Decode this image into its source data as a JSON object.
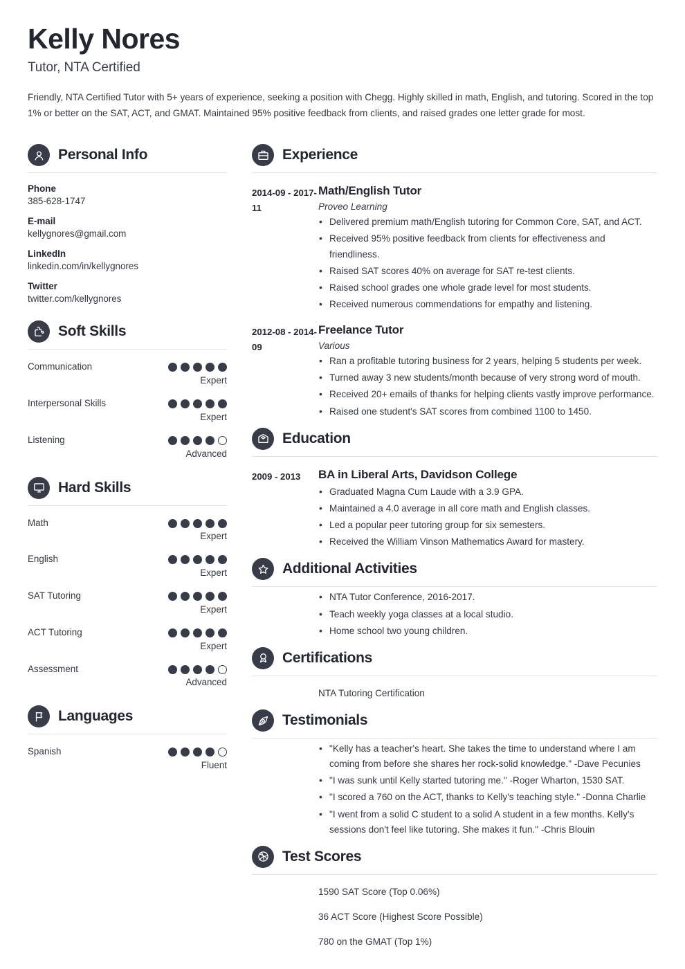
{
  "header": {
    "name": "Kelly Nores",
    "job_title": "Tutor, NTA Certified",
    "summary": "Friendly, NTA Certified Tutor with 5+ years of experience, seeking a position with Chegg. Highly skilled in math, English, and tutoring. Scored in the top 1% or better on the SAT, ACT, and GMAT. Maintained 95% positive feedback from clients, and raised grades one letter grade for most."
  },
  "theme": {
    "icon_circle": "#383c48",
    "text": "#33373f",
    "heading": "#23262f",
    "rule": "#e1e2e5"
  },
  "sidebar": {
    "personal_info": {
      "title": "Personal Info",
      "icon": "user-icon",
      "items": [
        {
          "label": "Phone",
          "value": "385-628-1747"
        },
        {
          "label": "E-mail",
          "value": "kellygnores@gmail.com"
        },
        {
          "label": "LinkedIn",
          "value": "linkedin.com/in/kellygnores"
        },
        {
          "label": "Twitter",
          "value": "twitter.com/kellygnores"
        }
      ]
    },
    "soft_skills": {
      "title": "Soft Skills",
      "icon": "puzzle-piece-icon",
      "items": [
        {
          "name": "Communication",
          "filled": 5,
          "total": 5,
          "level": "Expert"
        },
        {
          "name": "Interpersonal Skills",
          "filled": 5,
          "total": 5,
          "level": "Expert"
        },
        {
          "name": "Listening",
          "filled": 4,
          "total": 5,
          "level": "Advanced"
        }
      ]
    },
    "hard_skills": {
      "title": "Hard Skills",
      "icon": "monitor-icon",
      "items": [
        {
          "name": "Math",
          "filled": 5,
          "total": 5,
          "level": "Expert"
        },
        {
          "name": "English",
          "filled": 5,
          "total": 5,
          "level": "Expert"
        },
        {
          "name": "SAT Tutoring",
          "filled": 5,
          "total": 5,
          "level": "Expert"
        },
        {
          "name": "ACT Tutoring",
          "filled": 5,
          "total": 5,
          "level": "Expert"
        },
        {
          "name": "Assessment",
          "filled": 4,
          "total": 5,
          "level": "Advanced"
        }
      ]
    },
    "languages": {
      "title": "Languages",
      "icon": "flag-icon",
      "items": [
        {
          "name": "Spanish",
          "filled": 4,
          "total": 5,
          "level": "Fluent"
        }
      ]
    }
  },
  "main": {
    "experience": {
      "title": "Experience",
      "icon": "briefcase-icon",
      "entries": [
        {
          "date": "2014-09 - 2017-11",
          "title": "Math/English Tutor",
          "subtitle": "Proveo Learning",
          "bullets": [
            "Delivered premium math/English tutoring for Common Core, SAT, and ACT.",
            "Received 95% positive feedback from clients for effectiveness and friendliness.",
            "Raised SAT scores 40% on average for SAT re-test clients.",
            "Raised school grades one whole grade level for most students.",
            "Received numerous commendations for empathy and listening."
          ]
        },
        {
          "date": "2012-08 - 2014-09",
          "title": "Freelance Tutor",
          "subtitle": "Various",
          "bullets": [
            "Ran a profitable tutoring business for 2 years, helping 5 students per week.",
            "Turned away 3 new students/month because of very strong word of mouth.",
            "Received 20+ emails of thanks for helping clients vastly improve performance.",
            "Raised one student's SAT scores from combined 1100 to 1450."
          ]
        }
      ]
    },
    "education": {
      "title": "Education",
      "icon": "graduation-cap-icon",
      "entries": [
        {
          "date": "2009 - 2013",
          "title": "BA in Liberal Arts, Davidson College",
          "subtitle": "",
          "bullets": [
            "Graduated Magna Cum Laude with a 3.9 GPA.",
            "Maintained a 4.0 average in all core math and English classes.",
            "Led a popular peer tutoring group for six semesters.",
            "Received the William Vinson Mathematics Award for mastery."
          ]
        }
      ]
    },
    "additional_activities": {
      "title": "Additional Activities",
      "icon": "star-icon",
      "bullets": [
        "NTA Tutor Conference, 2016-2017.",
        "Teach weekly yoga classes at a local studio.",
        "Home school two young children."
      ]
    },
    "certifications": {
      "title": "Certifications",
      "icon": "award-ribbon-icon",
      "lines": [
        "NTA Tutoring Certification"
      ]
    },
    "testimonials": {
      "title": "Testimonials",
      "icon": "pen-nib-icon",
      "bullets": [
        "\"Kelly has a teacher's heart. She takes the time to understand where I am coming from before she shares her rock-solid knowledge.\" -Dave Pecunies",
        "\"I was sunk until Kelly started tutoring me.\" -Roger Wharton, 1530 SAT.",
        "\"I scored a 760 on the ACT, thanks to Kelly's teaching style.\" -Donna Charlie",
        "\"I went from a solid C student to a solid A student in a few months. Kelly's sessions don't feel like tutoring. She makes it fun.\" -Chris Blouin"
      ]
    },
    "test_scores": {
      "title": "Test Scores",
      "icon": "ball-icon",
      "lines": [
        "1590 SAT Score (Top 0.06%)",
        "36 ACT Score (Highest Score Possible)",
        "780 on the GMAT  (Top 1%)"
      ]
    }
  }
}
